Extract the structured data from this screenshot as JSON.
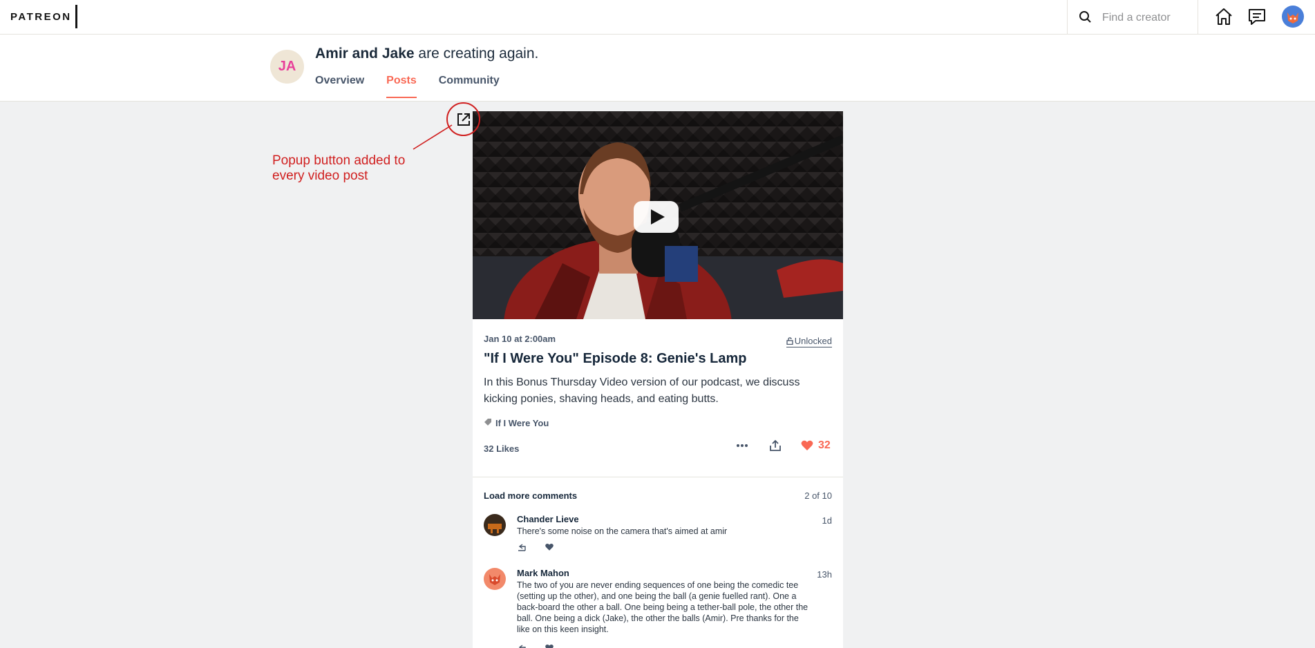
{
  "topnav": {
    "logo": "PATREON",
    "search_placeholder": "Find a creator"
  },
  "creator": {
    "initials": "JA",
    "name": "Amir and Jake",
    "tagline": " are creating again.",
    "tabs": [
      {
        "label": "Overview",
        "active": false
      },
      {
        "label": "Posts",
        "active": true
      },
      {
        "label": "Community",
        "active": false
      }
    ]
  },
  "annotation": {
    "text": "Popup button added to every video post"
  },
  "post": {
    "date": "Jan 10 at 2:00am",
    "lock_label": "Unlocked",
    "title": "\"If I Were You\" Episode 8: Genie's Lamp",
    "body": "In this Bonus Thursday Video version of our podcast, we discuss kicking ponies, shaving heads, and eating butts.",
    "tag": "If I Were You",
    "likes_label": "32 Likes",
    "like_count": "32"
  },
  "comments_section": {
    "load_more": "Load more comments",
    "pager": "2 of 10",
    "items": [
      {
        "author": "Chander Lieve",
        "time": "1d",
        "text": "There's some noise on the camera that's aimed at amir"
      },
      {
        "author": "Mark Mahon",
        "time": "13h",
        "text": "The two of you are never ending sequences of one being the comedic tee (setting up the other), and one being the ball (a genie fuelled rant). One a back-board the other a ball. One being being a tether-ball pole, the other the ball. One being a dick (Jake), the other the balls (Amir). Pre thanks for the like on this keen insight."
      }
    ]
  },
  "colors": {
    "accent": "#f96854",
    "annotation": "#d01f1f",
    "heading": "#16273a"
  }
}
